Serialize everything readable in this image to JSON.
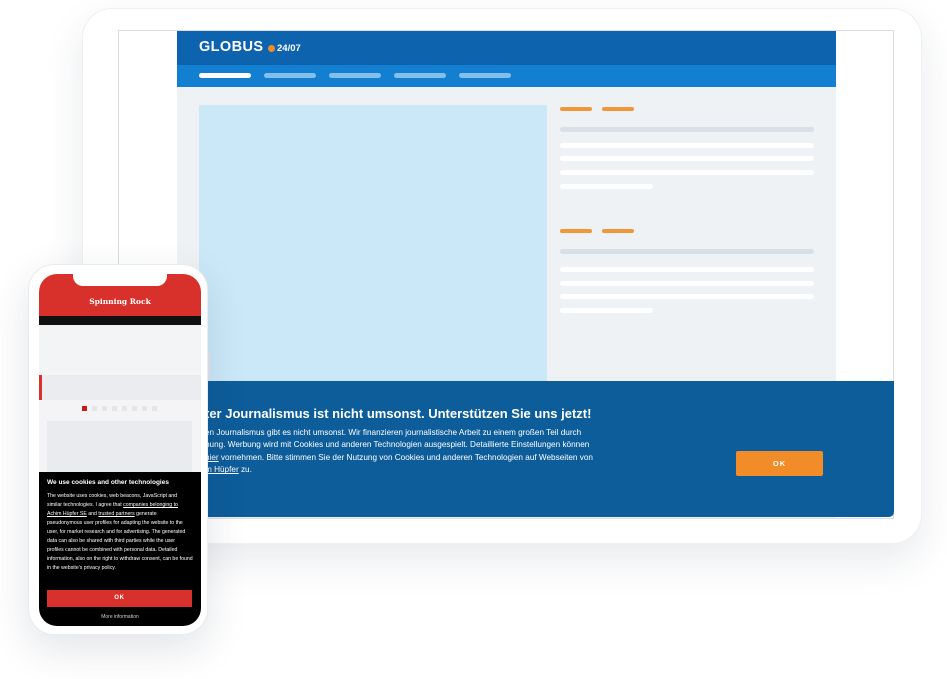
{
  "tablet_site": {
    "logo": "GLOBUS",
    "date": "24/07",
    "nav_items": [
      "",
      "",
      "",
      "",
      ""
    ],
    "colors": {
      "header": "#0d63ae",
      "nav": "#127fd0",
      "accent": "#f28c28",
      "banner": "#0d5d9b"
    }
  },
  "banner": {
    "title": "ter Journalismus ist nicht umsonst. Unterstützen Sie uns jetzt!",
    "text_1": "en Journalismus gibt es nicht umsonst. Wir finanzieren journalistische Arbeit zu einem großen Teil durch",
    "text_2": "bung. Werbung wird mit Cookies und anderen Technologien ausgespielt. Detaillierte Einstellungen können",
    "text_3_link": "hier",
    "text_3": " vornehmen. Bitte stimmen Sie der Nutzung von Cookies und anderen Technologien auf Webseiten von",
    "text_4_link": "m Hüpfer",
    "text_4": " zu.",
    "ok_label": "OK"
  },
  "phone_site": {
    "title": "Spinning Rock",
    "carousel_dots": 8,
    "active_dot": 0,
    "colors": {
      "header": "#d8312c",
      "consent_bg": "#000000"
    }
  },
  "consent": {
    "title": "We use cookies and other technologies",
    "text_1": "The website uses cookies, web beacons, JavaScript and similar technologies. I agree that ",
    "link_1": "companies belonging to Achim Hüpfer SE",
    "text_2": " and ",
    "link_2": "trusted partners",
    "text_3": " generate pseudonymous user profiles for adapting the website to the user, for market research and for advertising. The generated data can also be shared with third parties while the user profiles cannot be combined with personal data. Detailed information, also on the right to withdraw consent, can be found in the website's privacy policy.",
    "ok_label": "OK",
    "more_info": "More information"
  }
}
